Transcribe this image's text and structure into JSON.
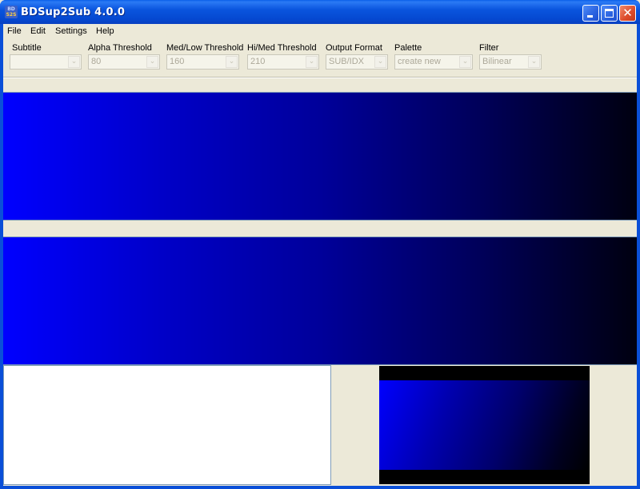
{
  "window": {
    "title": "BDSup2Sub 4.0.0",
    "icon": "bdsup2sub-app-icon",
    "icon_text_top": "BD",
    "icon_text_bottom": "S2S",
    "controls": {
      "minimize": "minimize-icon",
      "maximize": "maximize-icon",
      "close_glyph": "✕"
    }
  },
  "menu": {
    "items": [
      {
        "label": "File"
      },
      {
        "label": "Edit"
      },
      {
        "label": "Settings"
      },
      {
        "label": "Help"
      }
    ]
  },
  "toolbar": {
    "fields": [
      {
        "label": "Subtitle",
        "value": "",
        "disabled": true
      },
      {
        "label": "Alpha Threshold",
        "value": "80",
        "disabled": true
      },
      {
        "label": "Med/Low Threshold",
        "value": "160",
        "disabled": true
      },
      {
        "label": "Hi/Med Threshold",
        "value": "210",
        "disabled": true
      },
      {
        "label": "Output Format",
        "value": "SUB/IDX",
        "disabled": true
      },
      {
        "label": "Palette",
        "value": "create new",
        "disabled": true
      },
      {
        "label": "Filter",
        "value": "Bilinear",
        "disabled": true
      }
    ],
    "dropdown_glyph": "⌄"
  },
  "colors": {
    "titlebar": "#0a55de",
    "window_bg": "#ece9d8",
    "preview_gradient_start": "#0000ff",
    "preview_gradient_end": "#000010",
    "close_button": "#dc4a2a"
  }
}
